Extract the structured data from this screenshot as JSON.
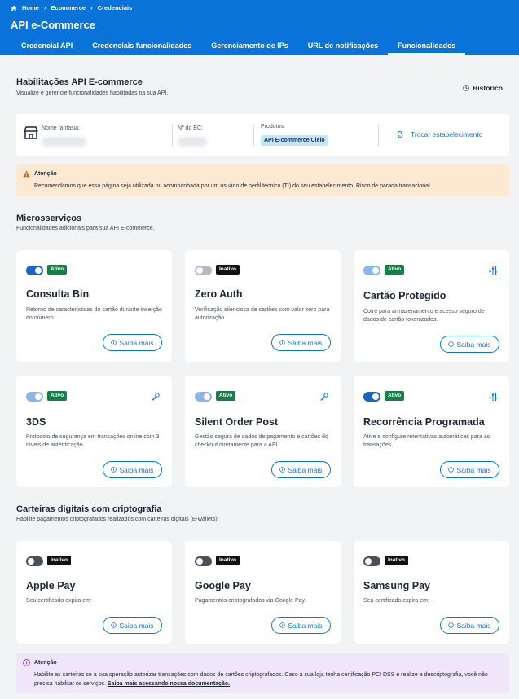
{
  "breadcrumb": {
    "home": "Home",
    "level1": "Ecommerce",
    "level2": "Credenciais"
  },
  "app_title": "API e-Commerce",
  "tabs": [
    {
      "label": "Credencial API"
    },
    {
      "label": "Credenciais funcionalidades"
    },
    {
      "label": "Gerenciamento de IPs"
    },
    {
      "label": "URL de notificações"
    },
    {
      "label": "Funcionalidades",
      "active": true
    }
  ],
  "habilitacoes": {
    "title": "Habilitações API E-commerce",
    "subtitle": "Visualize e gerencie funcionalidades habilitadas na sua API.",
    "historico": "Histórico"
  },
  "establishment": {
    "nome_label": "Nome fantasia:",
    "ec_label": "Nº do EC:",
    "produtos_label": "Produtos:",
    "produto_badge": "API E-commerce Cielo",
    "trocar": "Trocar estabelecimento"
  },
  "warning": {
    "title": "Atenção",
    "message": "Recomendamos que essa página seja utilizada ou acompanhada por um usuário de perfil técnico (TI) do seu estabelecimento. Risco de parada transacional."
  },
  "microservicos": {
    "title": "Microsserviços",
    "subtitle": "Funcionalidades adicionais para sua API E-commerce.",
    "cards": [
      {
        "title": "Consulta Bin",
        "status": "Ativo",
        "desc": "Retorno de características do cartão durante inserção do número.",
        "button": "Saiba mais",
        "icon": "none"
      },
      {
        "title": "Zero Auth",
        "status": "Inativo",
        "desc": "Verificação silenciosa de cartões com valor zero para autorização.",
        "button": "Saiba mais",
        "icon": "none"
      },
      {
        "title": "Cartão Protegido",
        "status": "Ativo",
        "desc": "Cofre para armazenamento e acesso seguro de dados de cartão tokenizados.",
        "button": "Saiba mais",
        "icon": "sliders-icon"
      },
      {
        "title": "3DS",
        "status": "Ativo",
        "desc": "Protocolo de segurança em transações online com 3 níveis de autenticação.",
        "button": "Saiba mais",
        "icon": "key-icon"
      },
      {
        "title": "Silent Order Post",
        "status": "Ativo",
        "desc": "Gestão segura de dados de pagamento e cartões do checkout diretamente para a API.",
        "button": "Saiba mais",
        "icon": "key-icon"
      },
      {
        "title": "Recorrência Programada",
        "status": "Ativo",
        "desc": "Ative e configure retentativas automáticas para as transações.",
        "button": "Saiba mais",
        "icon": "sliders-icon"
      }
    ]
  },
  "carteiras": {
    "title": "Carteiras digitais com criptografia",
    "subtitle": "Habilite pagamentos criptografados realizados com carteiras digitais (E-wallets).",
    "cards": [
      {
        "title": "Apple Pay",
        "status": "Inativo",
        "desc": "Seu certificado expira em: -",
        "button": "Saiba mais"
      },
      {
        "title": "Google Pay",
        "status": "Inativo",
        "desc": "Pagamentos criptografados via Google Pay.",
        "button": "Saiba mais"
      },
      {
        "title": "Samsung Pay",
        "status": "Inativo",
        "desc": "Seu certificado expira em: -",
        "button": "Saiba mais"
      }
    ]
  },
  "info": {
    "title": "Atenção",
    "message": "Habilite as carteiras se a sua operação autorizar transações com dados de cartões criptografados. Caso a sua loja tenha certificação PCI DSS e realize a descriptografia, você não precisa habilitar os serviços.",
    "link": "Saiba mais acessando nossa documentação."
  },
  "colors": {
    "primary": "#0a73d9",
    "active": "#157f47",
    "warning_bg": "#fde9d2",
    "info_bg": "#f0e6fa"
  }
}
